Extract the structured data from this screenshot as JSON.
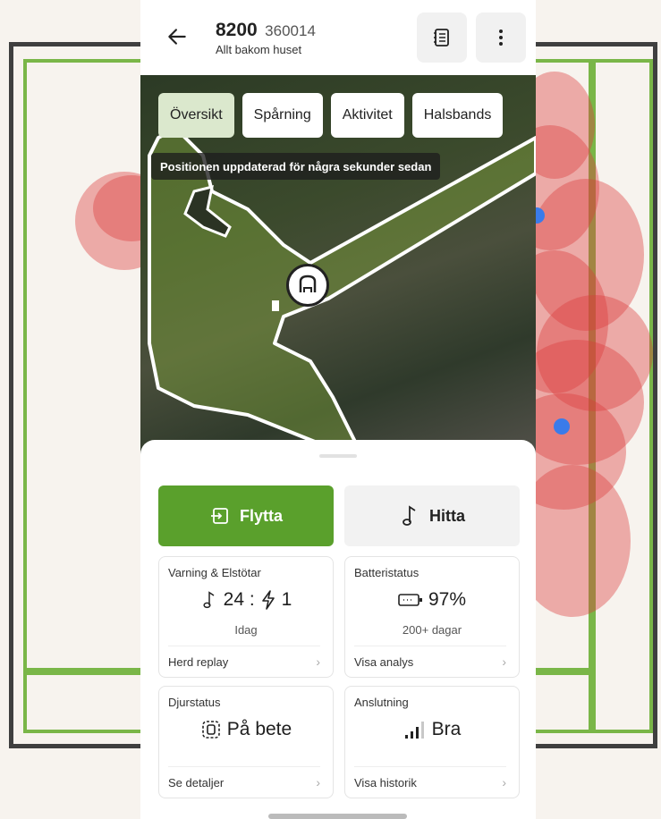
{
  "header": {
    "title": "8200",
    "id": "360014",
    "subtitle": "Allt bakom huset"
  },
  "tabs": [
    "Översikt",
    "Spårning",
    "Aktivitet",
    "Halsbands"
  ],
  "map": {
    "toast": "Positionen uppdaterad för några sekunder sedan"
  },
  "actions": {
    "move_label": "Flytta",
    "find_label": "Hitta"
  },
  "cards": {
    "warnings": {
      "title": "Varning & Elstötar",
      "value": "24 : ",
      "shocks": "1",
      "sub": "Idag",
      "link": "Herd replay"
    },
    "battery": {
      "title": "Batteristatus",
      "value": "97%",
      "sub": "200+ dagar",
      "link": "Visa analys"
    },
    "animal": {
      "title": "Djurstatus",
      "value": "På bete",
      "link": "Se detaljer"
    },
    "connection": {
      "title": "Anslutning",
      "value": "Bra",
      "link": "Visa historik"
    }
  },
  "colors": {
    "accent": "#5aa02c",
    "tab_active": "#dbe8cd",
    "zone_green": "#7ab648",
    "heat_red": "#dc3c3c"
  }
}
